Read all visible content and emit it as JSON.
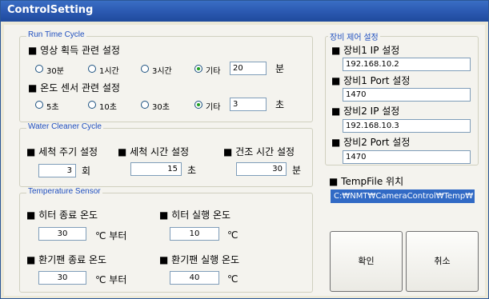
{
  "window": {
    "title": "ControlSetting"
  },
  "runtime": {
    "legend": "Run Time Cycle",
    "image_label": "■ 영상 획득 관련 설정",
    "image_options": [
      "30분",
      "1시간",
      "3시간",
      "기타"
    ],
    "image_selected": "기타",
    "image_value": "20",
    "image_unit": "분",
    "temp_label": "■ 온도 센서 관련 설정",
    "temp_options": [
      "5초",
      "10초",
      "30초",
      "기타"
    ],
    "temp_selected": "기타",
    "temp_value": "3",
    "temp_unit": "초"
  },
  "cleaner": {
    "legend": "Water Cleaner Cycle",
    "wash_period_label": "■ 세척 주기 설정",
    "wash_period_value": "3",
    "wash_period_unit": "회",
    "wash_time_label": "■ 세척 시간 설정",
    "wash_time_value": "15",
    "wash_time_unit": "초",
    "dry_time_label": "■ 건조 시간 설정",
    "dry_time_value": "30",
    "dry_time_unit": "분"
  },
  "temperature": {
    "legend": "Temperature Sensor",
    "heater_end_label": "■ 히터 종료 온도",
    "heater_end_value": "30",
    "heater_end_unit": "℃ 부터",
    "heater_run_label": "■ 히터 실행 온도",
    "heater_run_value": "10",
    "heater_run_unit": "℃",
    "fan_end_label": "■ 환기팬 종료 온도",
    "fan_end_value": "30",
    "fan_end_unit": "℃ 부터",
    "fan_run_label": "■ 환기팬 실행 온도",
    "fan_run_value": "40",
    "fan_run_unit": "℃"
  },
  "device": {
    "legend": "장비 제어 설정",
    "ip1_label": "■ 장비1 IP 설정",
    "ip1_value": "192.168.10.2",
    "port1_label": "■ 장비1 Port 설정",
    "port1_value": "1470",
    "ip2_label": "■ 장비2 IP 설정",
    "ip2_value": "192.168.10.3",
    "port2_label": "■ 장비2 Port 설정",
    "port2_value": "1470"
  },
  "tempfile": {
    "label": "■ TempFile 위치",
    "path": "C:₩NMT₩CameraControl₩Temp₩"
  },
  "buttons": {
    "ok": "확인",
    "cancel": "취소"
  },
  "colors": {
    "title_bar": "#2a58b0",
    "legend_text": "#1f4fbf",
    "radio_dot": "#21a121",
    "selection": "#316ac5"
  }
}
